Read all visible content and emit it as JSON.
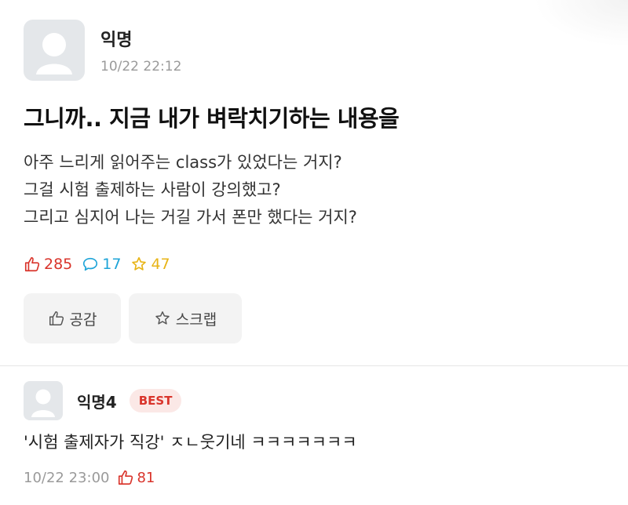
{
  "post": {
    "author": "익명",
    "time": "10/22 22:12",
    "title": "그니까.. 지금 내가 벼락치기하는 내용을",
    "body_lines": [
      "아주 느리게 읽어주는 class가 있었다는 거지?",
      "그걸 시험 출제하는 사람이 강의했고?",
      "그리고 심지어 나는 거길 가서 폰만 했다는 거지?"
    ],
    "stats": {
      "likes": "285",
      "comments": "17",
      "scraps": "47"
    },
    "actions": {
      "like_label": "공감",
      "scrap_label": "스크랩"
    }
  },
  "comment": {
    "author": "익명4",
    "badge": "BEST",
    "text": "'시험 출제자가 직강' ㅈㄴ웃기네 ㅋㅋㅋㅋㅋㅋㅋ",
    "time": "10/22 23:00",
    "likes": "81"
  },
  "icons": {
    "like": "thumbs-up-icon",
    "comment": "speech-bubble-icon",
    "scrap": "star-icon",
    "avatar": "default-user-icon"
  },
  "colors": {
    "like": "#d9342b",
    "comment": "#1ea4d8",
    "scrap": "#e8b416",
    "best_badge_bg": "#fbe8e6"
  }
}
